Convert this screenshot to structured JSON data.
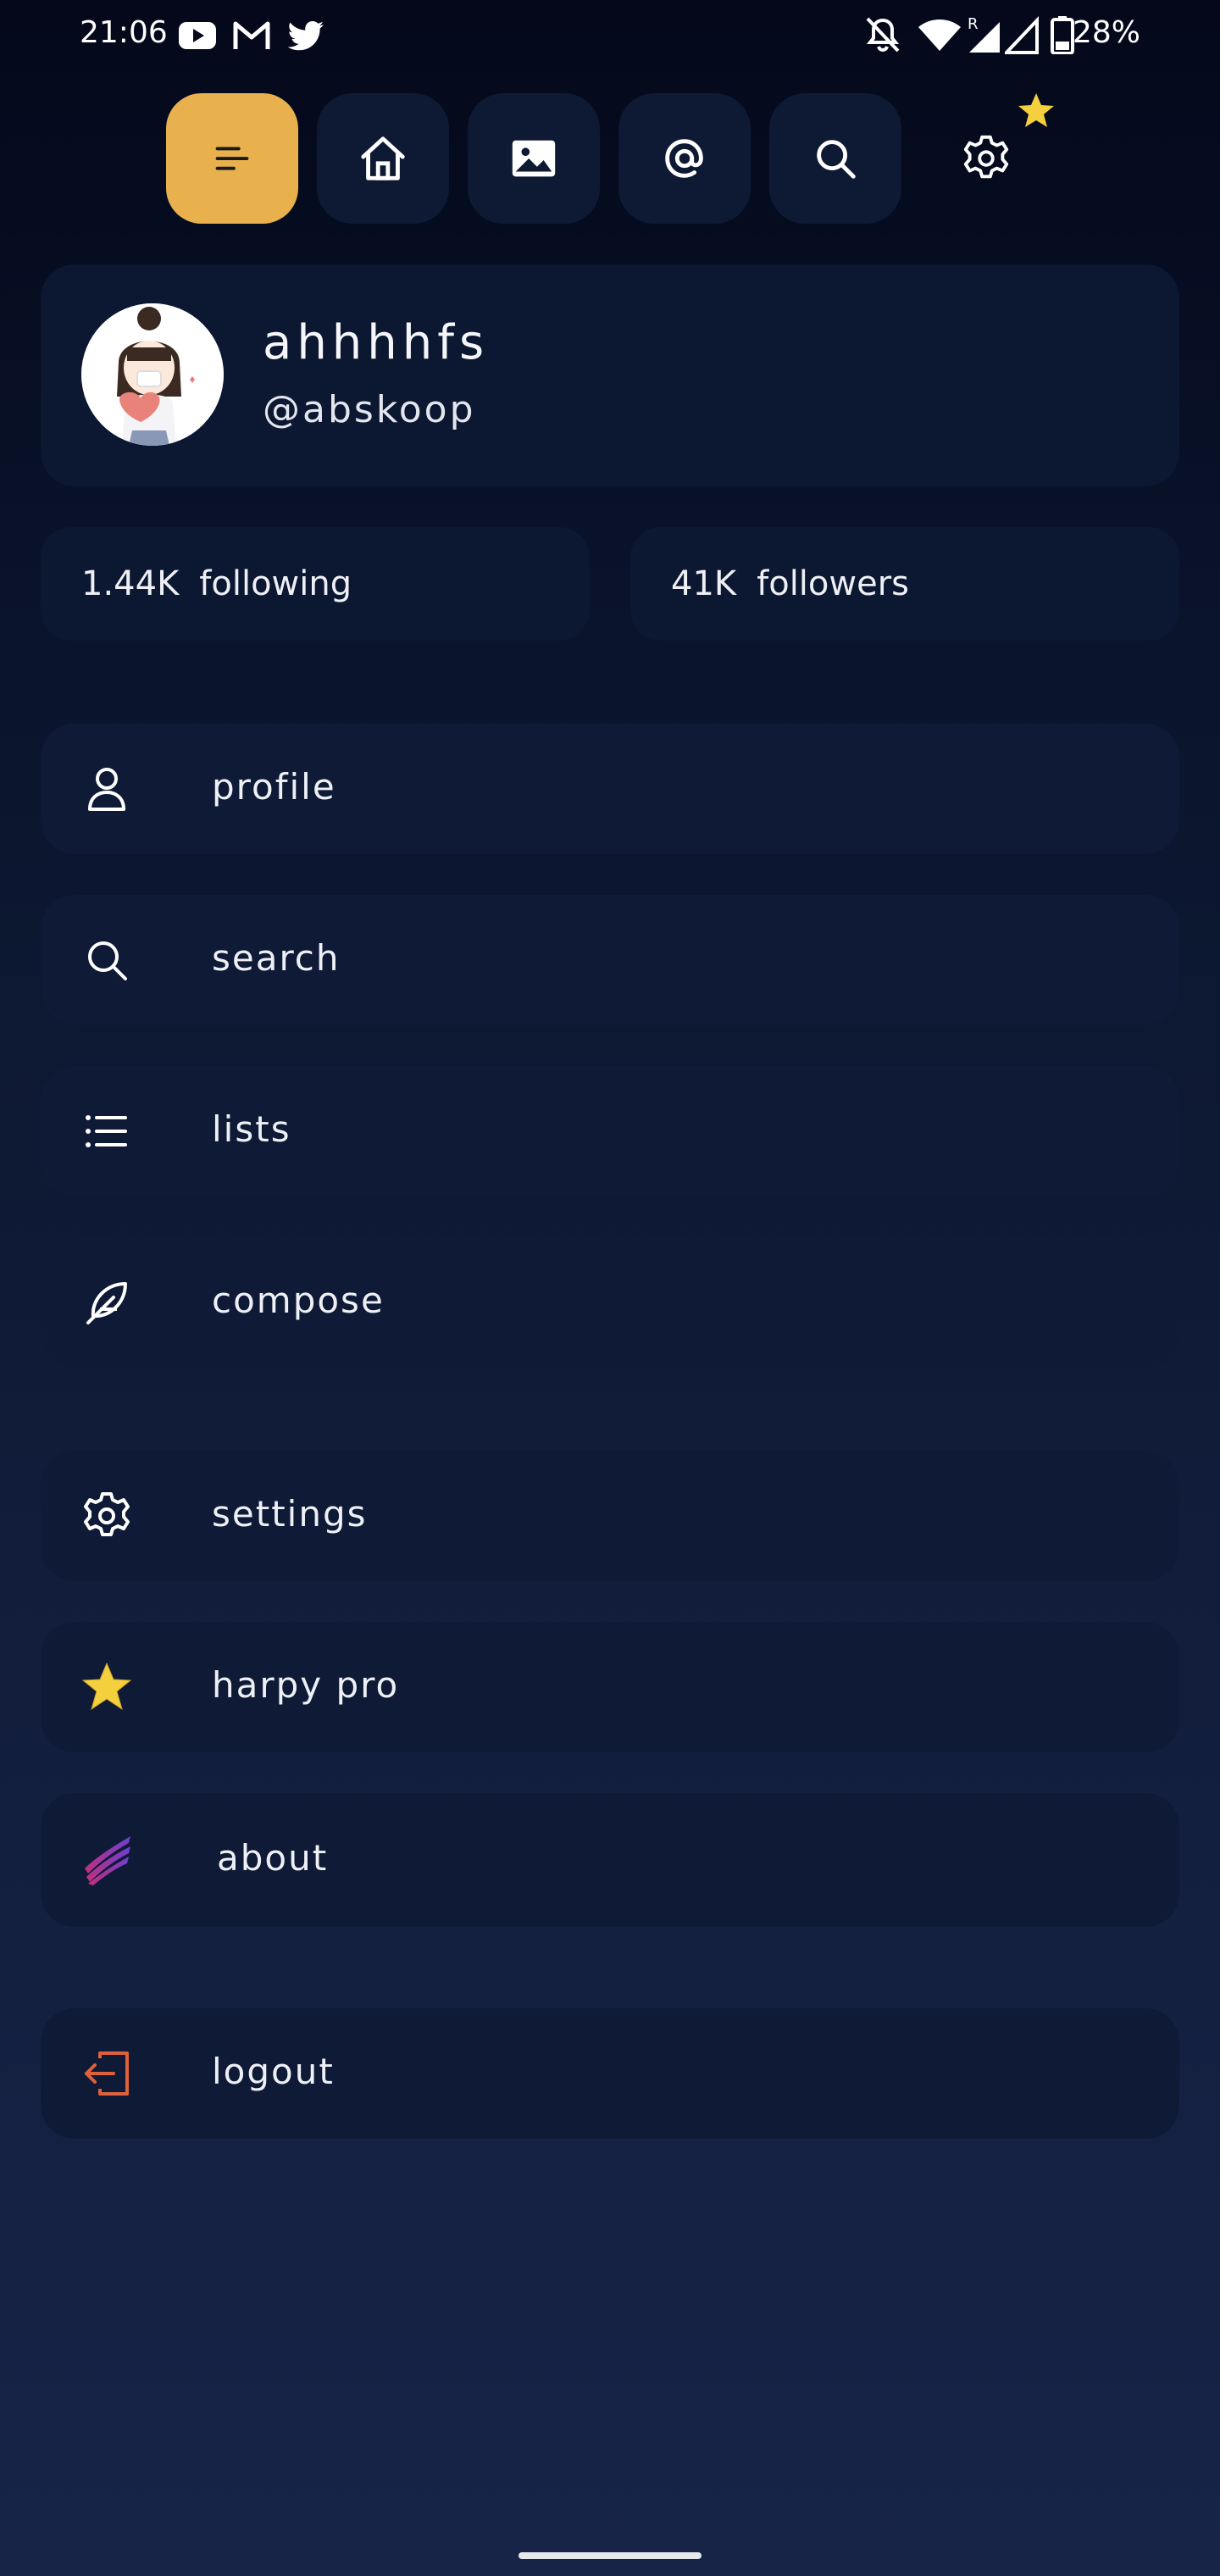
{
  "status_bar": {
    "time": "21:06",
    "app_icons": [
      "youtube-icon",
      "gmail-icon",
      "twitter-icon"
    ],
    "system_icons": [
      "notifications-off-icon",
      "wifi-icon",
      "signal-roaming-icon",
      "signal-icon",
      "battery-icon"
    ],
    "roaming_label": "R",
    "battery": "28%"
  },
  "tabs": [
    {
      "name": "menu",
      "icon": "menu-icon",
      "active": true
    },
    {
      "name": "home",
      "icon": "home-icon",
      "active": false
    },
    {
      "name": "media",
      "icon": "image-icon",
      "active": false
    },
    {
      "name": "mentions",
      "icon": "at-icon",
      "active": false
    },
    {
      "name": "search",
      "icon": "search-icon",
      "active": false
    },
    {
      "name": "settings",
      "icon": "gear-icon",
      "active": false
    }
  ],
  "profile": {
    "display_name": "ahhhhfs",
    "handle": "@abskoop"
  },
  "stats": {
    "following_count": "1.44K",
    "following_label": "following",
    "followers_count": "41K",
    "followers_label": "followers"
  },
  "menu": {
    "profile": "profile",
    "search": "search",
    "lists": "lists",
    "compose": "compose",
    "settings": "settings",
    "harpy_pro": "harpy pro",
    "about": "about",
    "logout": "logout"
  },
  "colors": {
    "accent": "#e8b14d",
    "card": "#0e1a36",
    "logout_icon": "#e0603a",
    "star": "#f4d03f"
  }
}
